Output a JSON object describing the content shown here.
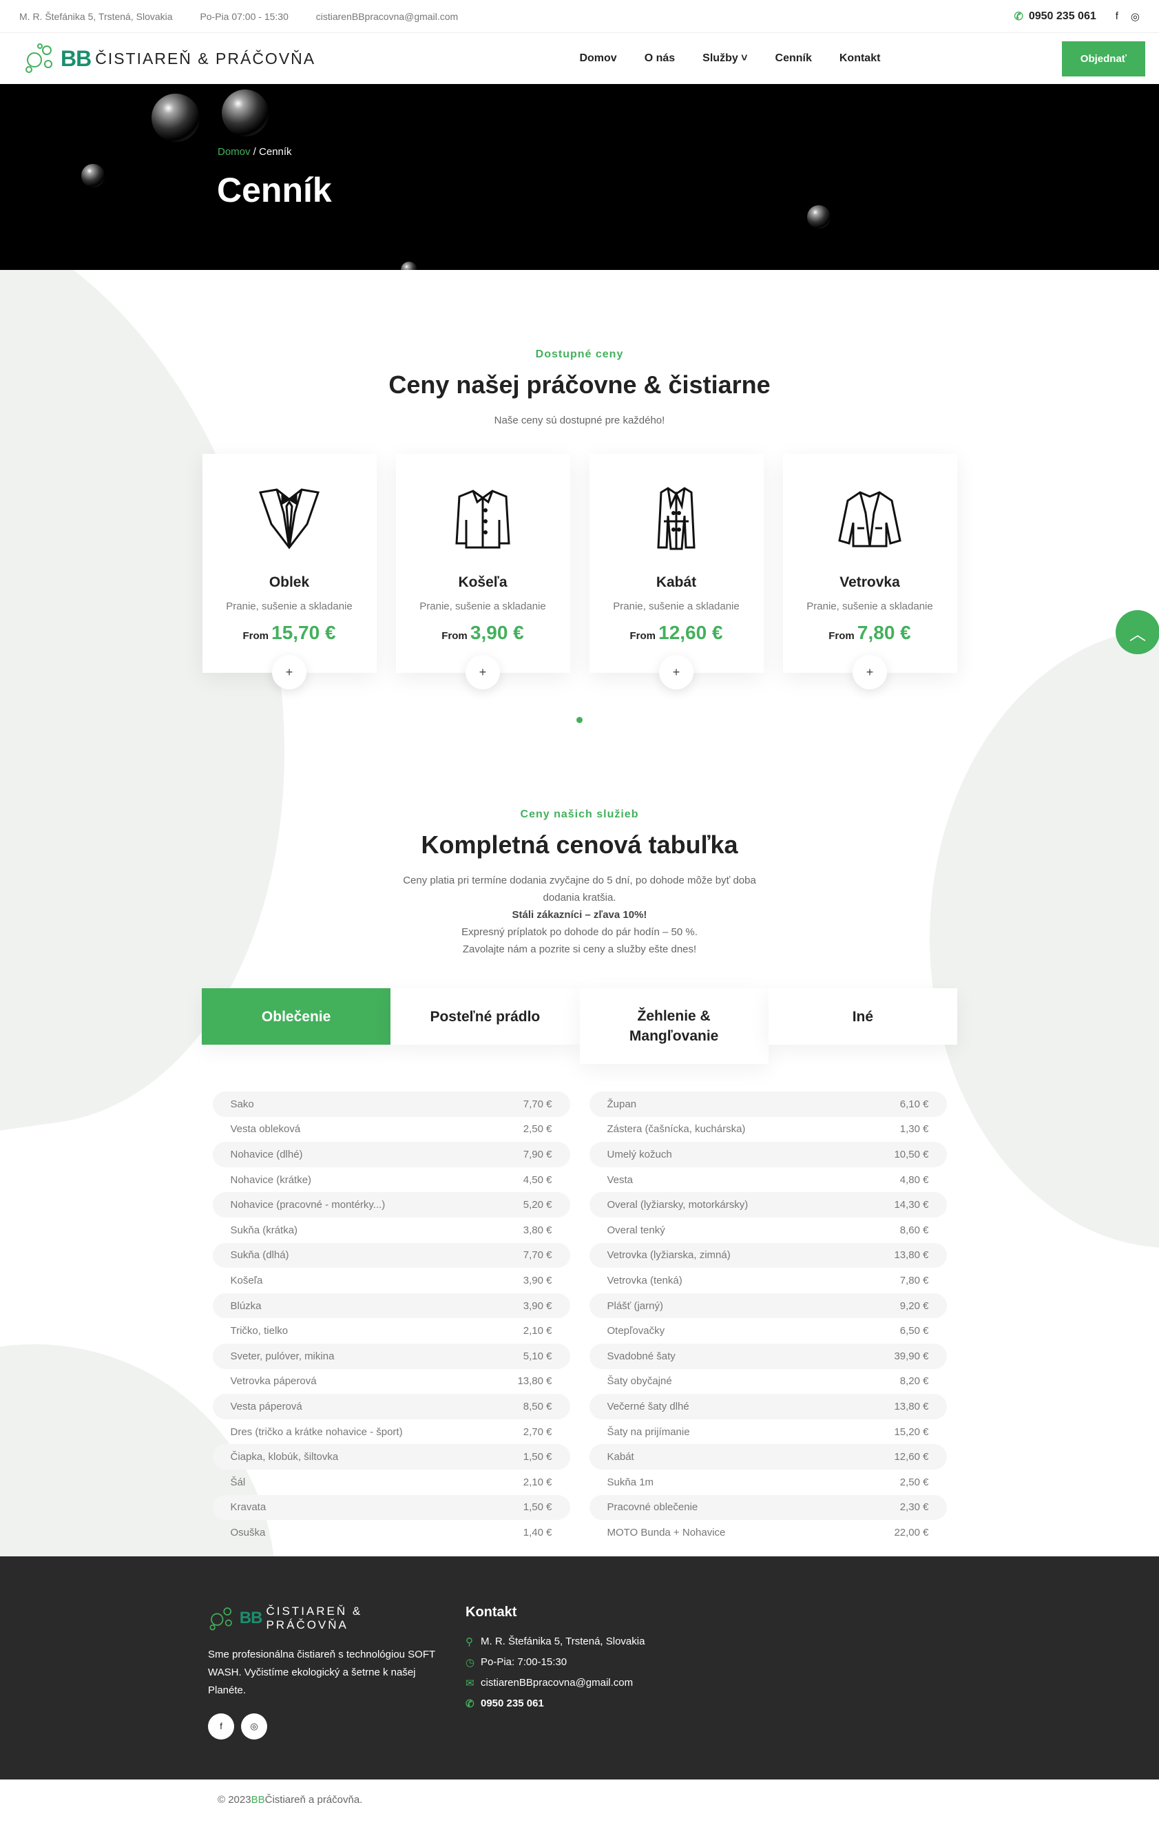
{
  "topbar": {
    "address": "M. R. Štefánika 5, Trstená, Slovakia",
    "hours": "Po-Pia 07:00 - 15:30",
    "email": "cistiarenBBpracovna@gmail.com",
    "phone": "0950 235 061"
  },
  "nav": {
    "logo_bb": "BB",
    "logo_text": "ČISTIAREŇ & PRÁČOVŇA",
    "items": [
      "Domov",
      "O nás",
      "Služby ˅",
      "Cenník",
      "Kontakt"
    ],
    "cta": "Objednať"
  },
  "hero": {
    "crumb_home": "Domov",
    "crumb_current": " / Cenník",
    "title": "Cenník"
  },
  "prices": {
    "eyebrow": "Dostupné ceny",
    "title": "Ceny našej práčovne & čistiarne",
    "subtitle": "Naše ceny sú dostupné pre každého!",
    "cards": [
      {
        "name": "Oblek",
        "desc": "Pranie, sušenie a skladanie",
        "from": "From",
        "price": "15,70 €",
        "icon": "suit-icon"
      },
      {
        "name": "Košeľa",
        "desc": "Pranie, sušenie a skladanie",
        "from": "From",
        "price": "3,90 €",
        "icon": "shirt-icon"
      },
      {
        "name": "Kabát",
        "desc": "Pranie, sušenie a skladanie",
        "from": "From",
        "price": "12,60 €",
        "icon": "coat-icon"
      },
      {
        "name": "Vetrovka",
        "desc": "Pranie, sušenie a skladanie",
        "from": "From",
        "price": "7,80 €",
        "icon": "jacket-icon"
      }
    ]
  },
  "table": {
    "eyebrow": "Ceny našich služieb",
    "title": "Kompletná cenová tabuľka",
    "lines": [
      "Ceny platia pri termíne dodania zvyčajne do 5 dní, po dohode môže byť doba",
      "dodania kratšia.",
      "Stáli zákazníci – zľava 10%!",
      "Expresný príplatok po dohode do pár hodín – 50 %.",
      "Zavolajte nám a pozrite si ceny a služby ešte dnes!"
    ],
    "tabs": [
      "Oblečenie",
      "Posteľné prádlo",
      "Žehlenie & Mangľovanie",
      "Iné"
    ],
    "left": [
      [
        "Sako",
        "7,70 €"
      ],
      [
        "Vesta obleková",
        "2,50 €"
      ],
      [
        "Nohavice (dlhé)",
        "7,90 €"
      ],
      [
        "Nohavice (krátke)",
        "4,50 €"
      ],
      [
        "Nohavice (pracovné - montérky...)",
        "5,20 €"
      ],
      [
        "Sukňa (krátka)",
        "3,80 €"
      ],
      [
        "Sukňa (dlhá)",
        "7,70 €"
      ],
      [
        "Košeľa",
        "3,90 €"
      ],
      [
        "Blúzka",
        "3,90 €"
      ],
      [
        "Tričko, tielko",
        "2,10 €"
      ],
      [
        "Sveter, pulóver, mikina",
        "5,10 €"
      ],
      [
        "Vetrovka páperová",
        "13,80 €"
      ],
      [
        "Vesta páperová",
        "8,50 €"
      ],
      [
        "Dres (tričko a krátke nohavice - šport)",
        "2,70 €"
      ],
      [
        "Čiapka, klobúk, šiltovka",
        "1,50 €"
      ],
      [
        "Šál",
        "2,10 €"
      ],
      [
        "Kravata",
        "1,50 €"
      ],
      [
        "Osuška",
        "1,40 €"
      ]
    ],
    "right": [
      [
        "Župan",
        "6,10 €"
      ],
      [
        "Zástera (čašnícka, kuchárska)",
        "1,30 €"
      ],
      [
        "Umelý kožuch",
        "10,50 €"
      ],
      [
        "Vesta",
        "4,80 €"
      ],
      [
        "Overal (lyžiarsky, motorkársky)",
        "14,30 €"
      ],
      [
        "Overal tenký",
        "8,60 €"
      ],
      [
        "Vetrovka (lyžiarska, zimná)",
        "13,80 €"
      ],
      [
        "Vetrovka (tenká)",
        "7,80 €"
      ],
      [
        "Plášť (jarný)",
        "9,20 €"
      ],
      [
        "Otepľovačky",
        "6,50 €"
      ],
      [
        "Svadobné šaty",
        "39,90 €"
      ],
      [
        "Šaty obyčajné",
        "8,20 €"
      ],
      [
        "Večerné šaty dlhé",
        "13,80 €"
      ],
      [
        "Šaty na prijímanie",
        "15,20 €"
      ],
      [
        "Kabát",
        "12,60 €"
      ],
      [
        "Sukňa 1m",
        "2,50 €"
      ],
      [
        "Pracovné oblečenie",
        "2,30 €"
      ],
      [
        "MOTO Bunda + Nohavice",
        "22,00 €"
      ]
    ]
  },
  "footer": {
    "logo_bb": "BB",
    "logo_text": "ČISTIAREŇ & PRÁČOVŇA",
    "about": "Sme profesionálna čistiareň s technológiou SOFT WASH. Vyčistíme ekologický a šetrne k našej Planéte.",
    "contact_title": "Kontakt",
    "address": "M. R. Štefánika 5, Trstená, Slovakia",
    "hours": "Po-Pia: 7:00-15:30",
    "email": "cistiarenBBpracovna@gmail.com",
    "phone": "0950 235 061",
    "copy_pre": "© 2023 ",
    "copy_bb": "BB",
    "copy_post": " Čistiareň a práčovňa."
  }
}
